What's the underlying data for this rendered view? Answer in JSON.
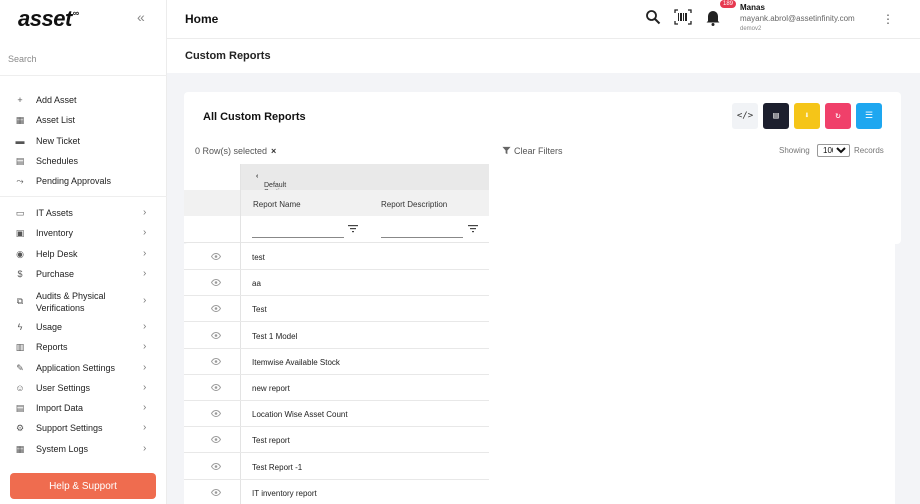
{
  "app": {
    "logo": "asset",
    "logo_mark": "∞"
  },
  "sidebar": {
    "search_placeholder": "Search",
    "quick": [
      {
        "label": "Add Asset",
        "icon": "plus-icon"
      },
      {
        "label": "Asset List",
        "icon": "asset-list-icon"
      },
      {
        "label": "New Ticket",
        "icon": "ticket-icon"
      },
      {
        "label": "Schedules",
        "icon": "calendar-icon"
      },
      {
        "label": "Pending Approvals",
        "icon": "approval-icon"
      }
    ],
    "modules": [
      {
        "label": "IT Assets",
        "icon": "laptop-icon"
      },
      {
        "label": "Inventory",
        "icon": "inventory-icon"
      },
      {
        "label": "Help Desk",
        "icon": "help-desk-icon"
      },
      {
        "label": "Purchase",
        "icon": "dollar-icon"
      },
      {
        "label": "Audits & Physical",
        "label2": "Verifications",
        "icon": "audit-icon"
      },
      {
        "label": "Usage",
        "icon": "bolt-icon"
      },
      {
        "label": "Reports",
        "icon": "reports-icon"
      },
      {
        "label": "Application Settings",
        "icon": "wrench-icon"
      },
      {
        "label": "User Settings",
        "icon": "user-settings-icon"
      },
      {
        "label": "Import Data",
        "icon": "import-icon"
      },
      {
        "label": "Support Settings",
        "icon": "support-settings-icon"
      },
      {
        "label": "System Logs",
        "icon": "logs-icon"
      }
    ],
    "help_button": "Help & Support"
  },
  "header": {
    "title": "Home",
    "notifications_count": "189",
    "user_name": "Manas",
    "user_email": "mayank.abrol@assetinfinity.com",
    "org": "demov2"
  },
  "page": {
    "title": "Custom Reports"
  },
  "card": {
    "title": "All Custom Reports",
    "rows_selected": "0 Row(s) selected",
    "clear_filters": "Clear Filters",
    "showing": "Showing",
    "per_page": "100",
    "per_page_options": [
      "100"
    ],
    "records": "Records",
    "toolbar": [
      {
        "icon": "code-icon",
        "glyph": "</>",
        "color": "#f1f3f6",
        "fg": "#333"
      },
      {
        "icon": "document-icon",
        "glyph": "▤",
        "color": "#1c1f2e",
        "fg": "#ffffff"
      },
      {
        "icon": "download-icon",
        "glyph": "⬇",
        "color": "#f5c518",
        "fg": "#ffffff"
      },
      {
        "icon": "refresh-icon",
        "glyph": "↻",
        "color": "#f0406a",
        "fg": "#ffffff"
      },
      {
        "icon": "columns-icon",
        "glyph": "☰",
        "color": "#1ea7f0",
        "fg": "#ffffff"
      }
    ]
  },
  "table": {
    "section": "Default Section",
    "columns": [
      "Report Name",
      "Report Description"
    ],
    "rows": [
      "test",
      "aa",
      "Test",
      "Test 1 Model",
      "Itemwise Available Stock",
      "new report",
      "Location Wise Asset Count",
      "Test report",
      "Test Report -1",
      "IT inventory report"
    ]
  }
}
